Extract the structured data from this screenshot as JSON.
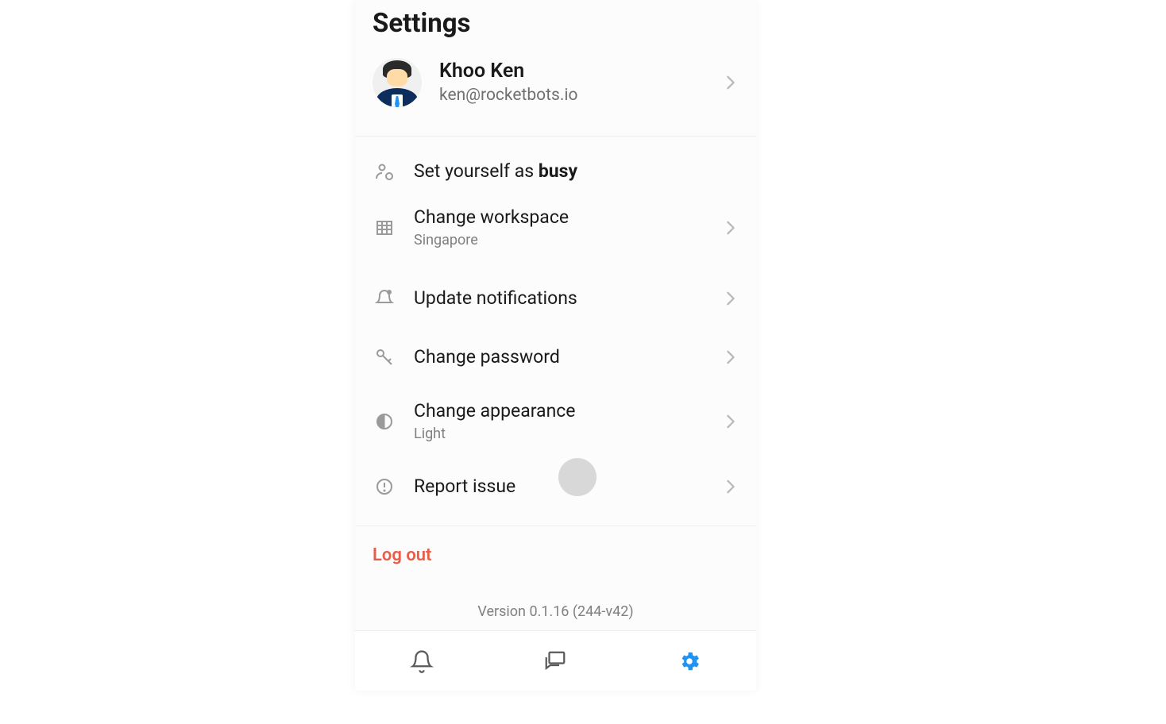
{
  "header": {
    "title": "Settings"
  },
  "profile": {
    "name": "Khoo Ken",
    "email": "ken@rocketbots.io"
  },
  "status": {
    "label_prefix": "Set yourself as ",
    "label_bold": "busy"
  },
  "menu": {
    "workspace": {
      "label": "Change workspace",
      "value": "Singapore"
    },
    "notifications": {
      "label": "Update notifications"
    },
    "password": {
      "label": "Change password"
    },
    "appearance": {
      "label": "Change appearance",
      "value": "Light"
    },
    "report": {
      "label": "Report issue"
    }
  },
  "logout": {
    "label": "Log out"
  },
  "version": {
    "label": "Version 0.1.16 (244-v42)"
  }
}
